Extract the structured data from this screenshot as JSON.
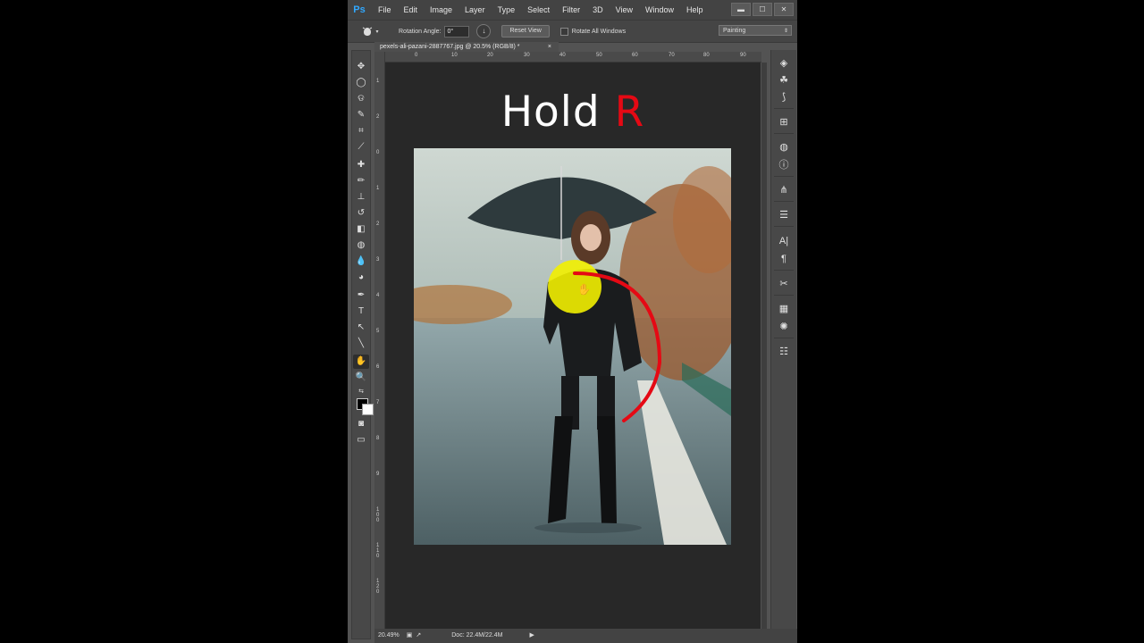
{
  "app": {
    "logo": "Ps"
  },
  "menu": [
    "File",
    "Edit",
    "Image",
    "Layer",
    "Type",
    "Select",
    "Filter",
    "3D",
    "View",
    "Window",
    "Help"
  ],
  "window_controls": {
    "minimize": "▬",
    "maximize": "☐",
    "close": "✕"
  },
  "options": {
    "tool_icon": "hand-rotate-icon",
    "rotation_label": "Rotation Angle:",
    "rotation_value": "0°",
    "reset_label": "Reset View",
    "rotate_all_label": "Rotate All Windows",
    "workspace": "Painting"
  },
  "document": {
    "tab_title": "pexels-ali-pazani-2887767.jpg @ 20.5% (RGB/8) *",
    "close": "×"
  },
  "ruler_top": [
    "0",
    "10",
    "20",
    "30",
    "40",
    "50",
    "60",
    "70",
    "80",
    "90"
  ],
  "ruler_left": [
    "1",
    "2",
    "0",
    "1",
    "2",
    "3",
    "4",
    "5",
    "6",
    "7",
    "8",
    "9",
    "100",
    "110",
    "120"
  ],
  "canvas": {
    "title": "Hold ",
    "title_accent": "R",
    "accent_color": "#e50914",
    "highlight_color": "#f2f000"
  },
  "status": {
    "zoom": "20.49%",
    "doc": "Doc: 22.4M/22.4M",
    "arrow": "▶"
  }
}
